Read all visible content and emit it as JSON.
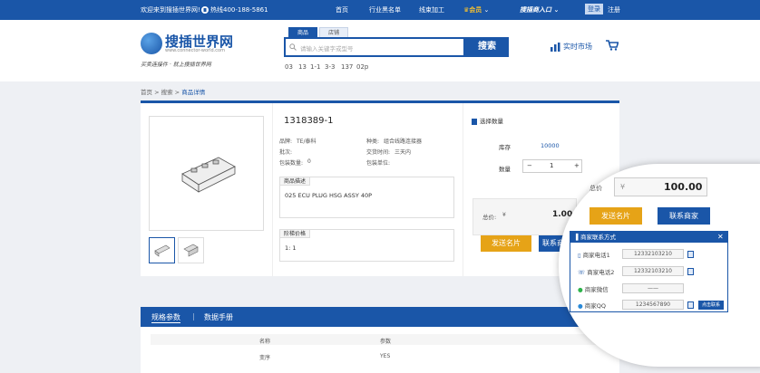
{
  "topbar": {
    "welcome": "欢迎来到搜插世界网!",
    "hotline": "热线400-188-5861",
    "nav": [
      "首页",
      "行业黑名单",
      "线束加工",
      "会员",
      "搜插商入口",
      "登录",
      "注册"
    ]
  },
  "header": {
    "logo_title": "搜插世界网",
    "logo_url": "www.connector-world.com",
    "slogan": "买卖连接件 · 就上搜插世界网",
    "search_tabs": [
      "商品",
      "店铺"
    ],
    "search_placeholder": "请输入关键字或型号",
    "search_button": "搜索",
    "hot_keywords": [
      "03",
      "13",
      "1-1",
      "3-3",
      "137",
      "02p"
    ],
    "market_link": "实时市场"
  },
  "breadcrumb": [
    "首页",
    "搜索",
    "商品详情"
  ],
  "product": {
    "part_number": "1318389-1",
    "brand_label": "品牌:",
    "brand": "TE/泰科",
    "type_label": "种类:",
    "type": "组合线路连接器",
    "batch_label": "批次:",
    "batch": "",
    "delivery_label": "交货时间:",
    "delivery": "三天内",
    "pack_qty_label": "包装数量:",
    "pack_qty": "0",
    "pack_unit_label": "包装单位:",
    "pack_unit": "",
    "desc_tab": "商品描述",
    "description": "025 ECU PLUG HSG ASSY 40P",
    "ladder_tab": "阶梯价格",
    "ladder": "1: 1"
  },
  "buy": {
    "heading": "选择数量",
    "stock_label": "库存",
    "stock": "10000",
    "qty_label": "数量",
    "qty": "1",
    "minus": "−",
    "plus": "+",
    "total_label": "总价:",
    "currency": "¥",
    "total": "1.00",
    "send_card": "发送名片",
    "contact": "联系商家"
  },
  "tabs": [
    "规格参数",
    "数据手册"
  ],
  "spec_table": {
    "headers": [
      "名称",
      "参数"
    ],
    "rows": [
      [
        "变序",
        "YES"
      ]
    ]
  },
  "zoom": {
    "total_label": "总价",
    "currency": "¥",
    "total": "100.00",
    "send_card": "发送名片",
    "contact": "联系商家",
    "panel_title": "商家联系方式",
    "close": "✕",
    "phone1_label": "商家电话1",
    "phone1": "12332103210",
    "phone2_label": "商家电话2",
    "phone2": "12332103210",
    "wechat_label": "商家微信",
    "wechat": "——",
    "qq_label": "商家QQ",
    "qq": "1234567890",
    "qq_button": "点击联系"
  },
  "colors": {
    "primary": "#1a56a8",
    "accent": "#e6a317"
  }
}
